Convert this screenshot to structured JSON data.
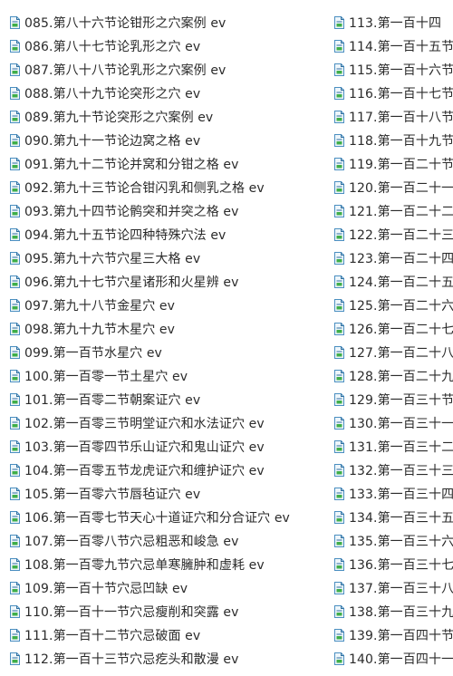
{
  "file_list": {
    "left_column": [
      "085.第八十六节论钳形之穴案例 ev",
      "086.第八十七节论乳形之穴 ev",
      "087.第八十八节论乳形之穴案例 ev",
      "088.第八十九节论突形之穴 ev",
      "089.第九十节论突形之穴案例 ev",
      "090.第九十一节论边窝之格 ev",
      "091.第九十二节论并窝和分钳之格 ev",
      "092.第九十三节论合钳闪乳和侧乳之格 ev",
      "093.第九十四节论鹘突和并突之格 ev",
      "094.第九十五节论四种特殊穴法 ev",
      "095.第九十六节穴星三大格 ev",
      "096.第九十七节穴星诸形和火星辨 ev",
      "097.第九十八节金星穴 ev",
      "098.第九十九节木星穴 ev",
      "099.第一百节水星穴 ev",
      "100.第一百零一节土星穴 ev",
      "101.第一百零二节朝案证穴 ev",
      "102.第一百零三节明堂证穴和水法证穴 ev",
      "103.第一百零四节乐山证穴和鬼山证穴 ev",
      "104.第一百零五节龙虎证穴和缠护证穴 ev",
      "105.第一百零六节唇毡证穴 ev",
      "106.第一百零七节天心十道证穴和分合证穴 ev",
      "107.第一百零八节穴忌粗恶和峻急 ev",
      "108.第一百零九节穴忌单寒臃肿和虚耗 ev",
      "109.第一百十节穴忌凹缺 ev",
      "110.第一百十一节穴忌瘦削和突露 ev",
      "111.第一百十二节穴忌破面 ev",
      "112.第一百十三节穴忌疙头和散漫 ev"
    ],
    "right_column": [
      "113.第一百十四",
      "114.第一百十五节",
      "115.第一百十六节",
      "116.第一百十七节",
      "117.第一百十八节",
      "118.第一百十九节",
      "119.第一百二十节",
      "120.第一百二十一",
      "121.第一百二十二",
      "122.第一百二十三",
      "123.第一百二十四",
      "124.第一百二十五",
      "125.第一百二十六",
      "126.第一百二十七",
      "127.第一百二十八",
      "128.第一百二十九",
      "129.第一百三十节",
      "130.第一百三十一",
      "131.第一百三十二",
      "132.第一百三十三",
      "133.第一百三十四",
      "134.第一百三十五",
      "135.第一百三十六",
      "136.第一百三十七",
      "137.第一百三十八",
      "138.第一百三十九",
      "139.第一百四十节",
      "140.第一百四十一"
    ],
    "icon": "document-file-icon",
    "colors": {
      "icon_page": "#eef6fb",
      "icon_border": "#4b8fc0",
      "icon_fold": "#2f6f9f",
      "icon_accent": "#3fae49",
      "text": "#2b2b2b"
    }
  }
}
